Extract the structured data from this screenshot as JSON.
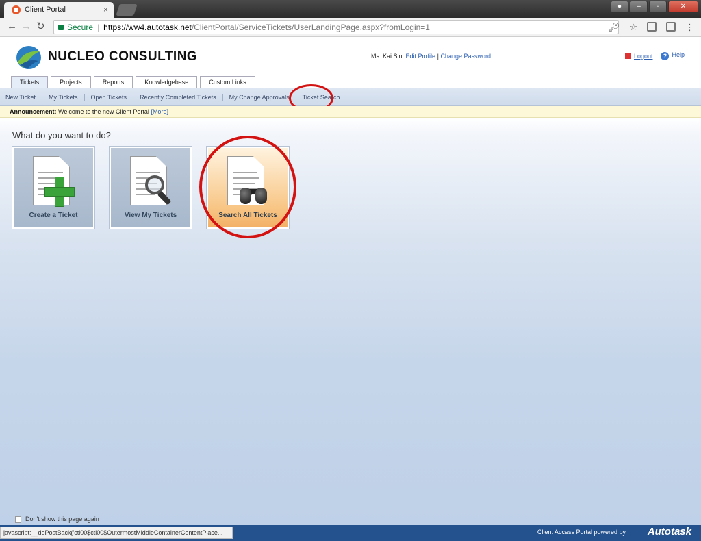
{
  "browser": {
    "tab_title": "Client Portal",
    "tab_close": "×",
    "url_secure_label": "Secure",
    "url_host": "https://ww4.autotask.net",
    "url_path": "/ClientPortal/ServiceTickets/UserLandingPage.aspx?fromLogin=1"
  },
  "header": {
    "company": "NUCLEO CONSULTING",
    "user_name": "Ms. Kai Sin",
    "edit_profile": "Edit Profile",
    "change_password": "Change Password",
    "logout": "Logout",
    "help": "Help"
  },
  "main_tabs": [
    "Tickets",
    "Projects",
    "Reports",
    "Knowledgebase",
    "Custom Links"
  ],
  "sub_nav": [
    "New Ticket",
    "My Tickets",
    "Open Tickets",
    "Recently Completed Tickets",
    "My Change Approvals",
    "Ticket Search"
  ],
  "announcement": {
    "label": "Announcement:",
    "text": "Welcome to the new Client Portal",
    "more": "[More]"
  },
  "content": {
    "question": "What do you want to do?",
    "tiles": [
      "Create a Ticket",
      "View My Tickets",
      "Search All Tickets"
    ],
    "dont_show": "Don't show this page again"
  },
  "footer": {
    "status_text": "javascript:__doPostBack('ctl00$ctl00$OutermostMiddleContainerContentPlace...",
    "powered_by": "Client Access Portal powered by",
    "brand": "Autotask"
  },
  "colors": {
    "annotation_circle": "#d31212",
    "footer_bg": "#24528e",
    "link": "#2a5db0"
  }
}
